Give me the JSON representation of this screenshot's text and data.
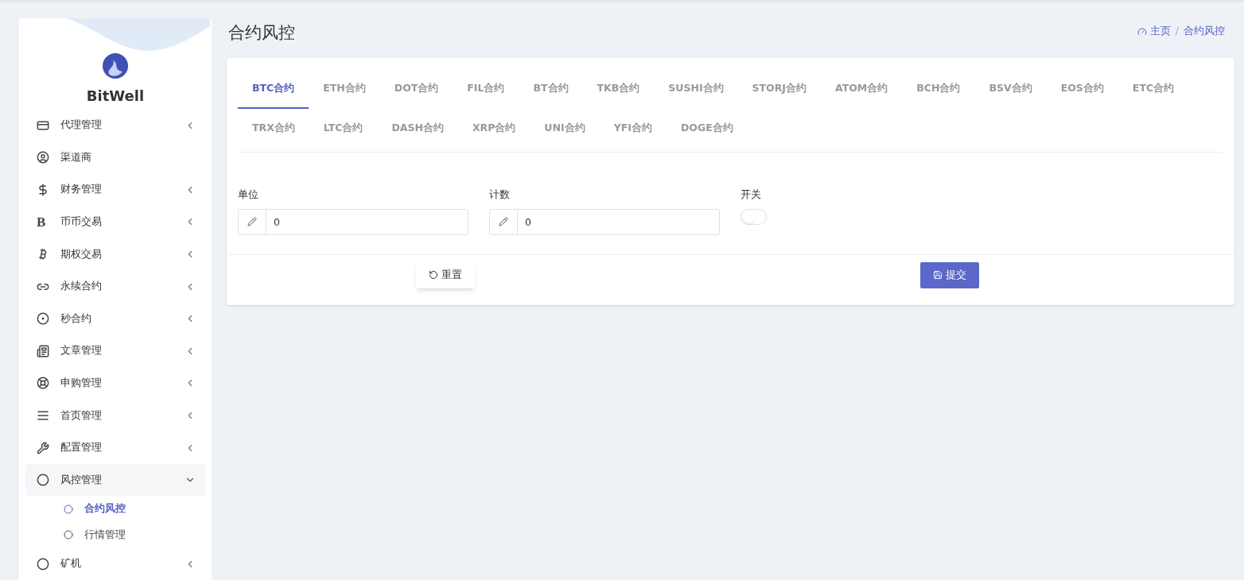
{
  "brand": {
    "name": "BitWell"
  },
  "sidebar": {
    "items": [
      {
        "label": "代理管理",
        "has_arrow": true,
        "expanded": false
      },
      {
        "label": "渠道商",
        "has_arrow": false
      },
      {
        "label": "财务管理",
        "has_arrow": true,
        "expanded": false
      },
      {
        "label": "币币交易",
        "glyph": "B",
        "has_arrow": true,
        "expanded": false
      },
      {
        "label": "期权交易",
        "has_arrow": true,
        "expanded": false
      },
      {
        "label": "永续合约",
        "has_arrow": true,
        "expanded": false
      },
      {
        "label": "秒合约",
        "has_arrow": true,
        "expanded": false
      },
      {
        "label": "文章管理",
        "has_arrow": true,
        "expanded": false
      },
      {
        "label": "申购管理",
        "has_arrow": true,
        "expanded": false
      },
      {
        "label": "首页管理",
        "has_arrow": true,
        "expanded": false
      },
      {
        "label": "配置管理",
        "has_arrow": true,
        "expanded": false
      },
      {
        "label": "风控管理",
        "has_arrow": true,
        "expanded": true,
        "children": [
          {
            "label": "合约风控",
            "selected": true
          },
          {
            "label": "行情管理",
            "selected": false
          }
        ]
      },
      {
        "label": "矿机",
        "has_arrow": true,
        "expanded": false
      }
    ]
  },
  "page": {
    "title": "合约风控"
  },
  "breadcrumb": {
    "separator": "/",
    "items": [
      {
        "label": "主页",
        "kind": "home"
      },
      {
        "label": "合约风控",
        "kind": "current"
      }
    ]
  },
  "tabs": [
    {
      "label": "BTC合约",
      "selected": true
    },
    {
      "label": "ETH合约",
      "selected": false
    },
    {
      "label": "DOT合约",
      "selected": false
    },
    {
      "label": "FIL合约",
      "selected": false
    },
    {
      "label": "BT合约",
      "selected": false
    },
    {
      "label": "TKB合约",
      "selected": false
    },
    {
      "label": "SUSHI合约",
      "selected": false
    },
    {
      "label": "STORJ合约",
      "selected": false
    },
    {
      "label": "ATOM合约",
      "selected": false
    },
    {
      "label": "BCH合约",
      "selected": false
    },
    {
      "label": "BSV合约",
      "selected": false
    },
    {
      "label": "EOS合约",
      "selected": false
    },
    {
      "label": "ETC合约",
      "selected": false
    },
    {
      "label": "TRX合约",
      "selected": false
    },
    {
      "label": "LTC合约",
      "selected": false
    },
    {
      "label": "DASH合约",
      "selected": false
    },
    {
      "label": "XRP合约",
      "selected": false
    },
    {
      "label": "UNI合约",
      "selected": false
    },
    {
      "label": "YFI合约",
      "selected": false
    },
    {
      "label": "DOGE合约",
      "selected": false
    }
  ],
  "form": {
    "fields": [
      {
        "label": "单位",
        "value": "0"
      },
      {
        "label": "计数",
        "value": "0"
      }
    ],
    "switch": {
      "label": "开关",
      "on": false
    }
  },
  "buttons": {
    "reset": "重置",
    "submit": "提交"
  }
}
